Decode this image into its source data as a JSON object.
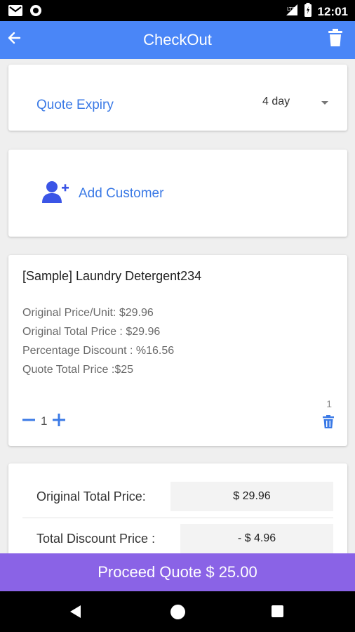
{
  "status_bar": {
    "time": "12:01",
    "left_icons": [
      "gmail-icon",
      "sync-icon"
    ],
    "right_icons": [
      "signal-icon",
      "battery-icon"
    ]
  },
  "app_bar": {
    "title": "CheckOut",
    "back_icon": "arrow-left-icon",
    "trash_icon": "trash-icon",
    "color": "#4a86f7"
  },
  "quote_expiry": {
    "label": "Quote Expiry",
    "value": "4 day"
  },
  "customer": {
    "label": "Add Customer",
    "icon": "person-add-icon"
  },
  "product": {
    "name": "[Sample] Laundry Detergent234",
    "original_price_unit": "Original Price/Unit: $29.96",
    "original_total_price": "Original Total Price : $29.96",
    "percentage_discount": "Percentage Discount : %16.56",
    "quote_total_price": "Quote Total Price :$25",
    "quantity": "1",
    "count": "1"
  },
  "totals": {
    "original_label": "Original Total Price:",
    "original_value": "$ 29.96",
    "discount_label": "Total Discount Price :",
    "discount_value": "- $ 4.96"
  },
  "proceed": {
    "label": "Proceed Quote $ 25.00",
    "color": "#8a63e6"
  },
  "accent_color": "#3b7ae6"
}
